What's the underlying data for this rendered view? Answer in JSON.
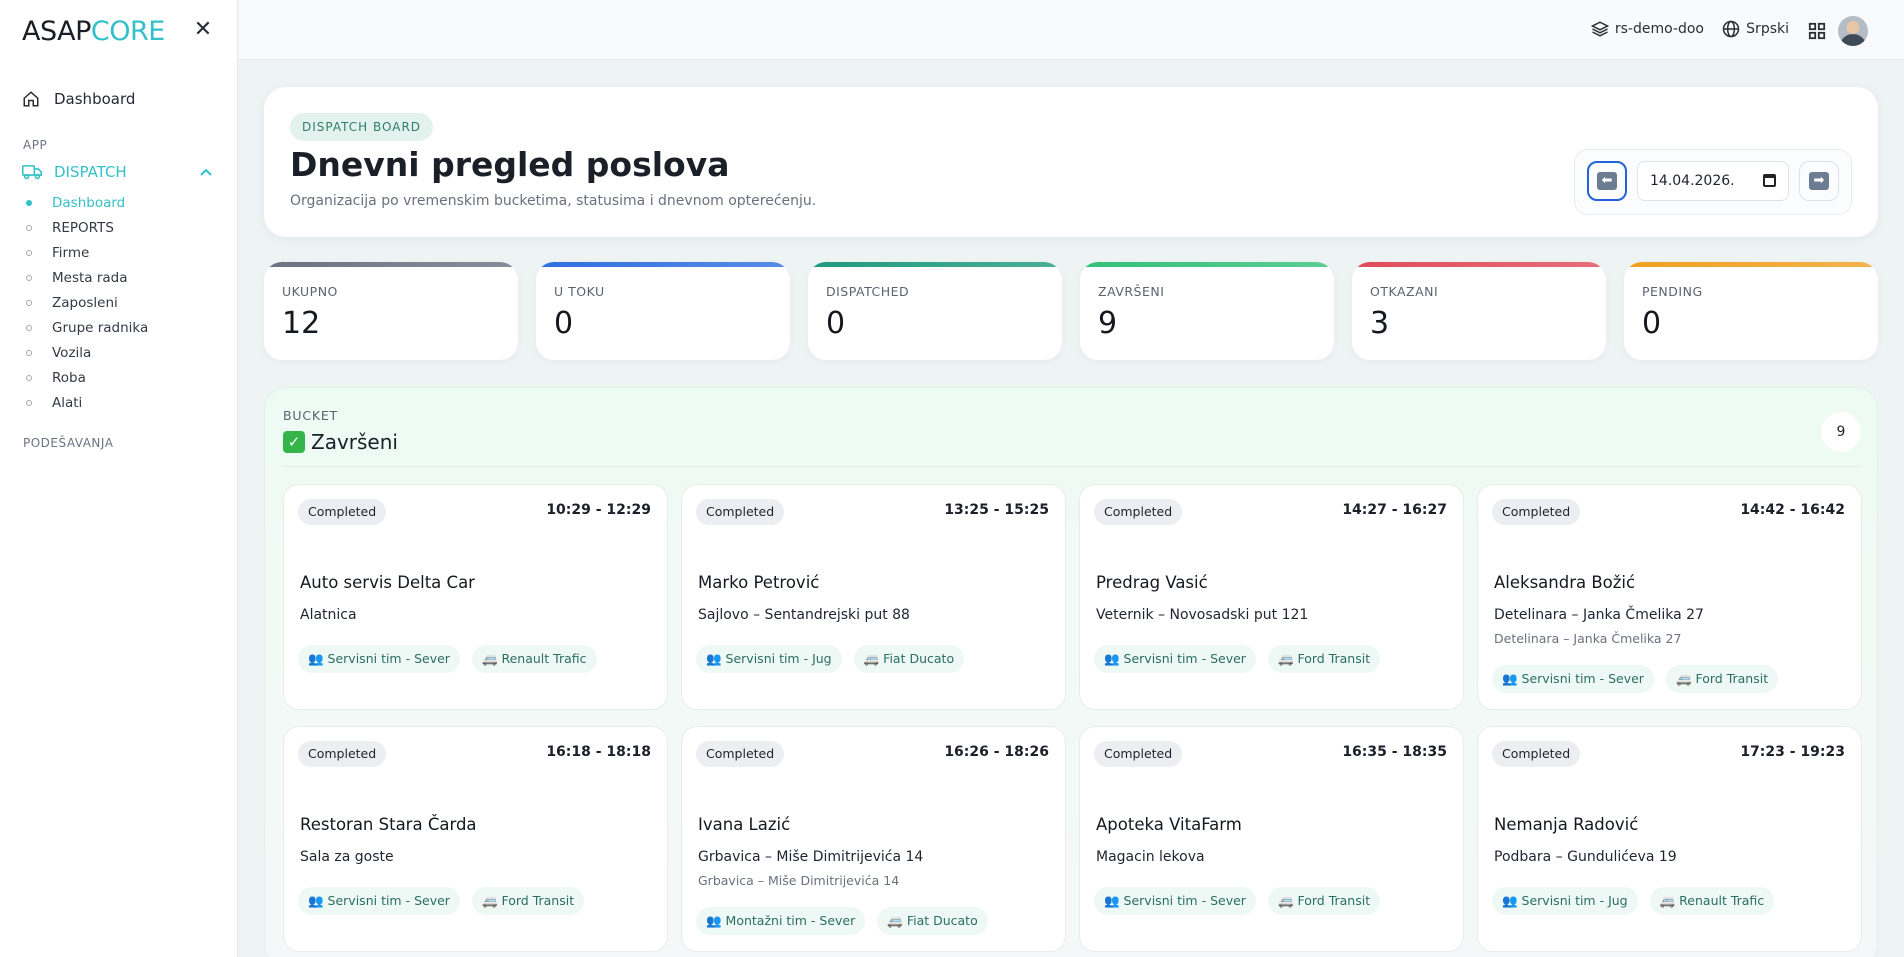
{
  "brand": {
    "part1": "ASAP",
    "part2": "CORE"
  },
  "sidebar": {
    "top_item": "Dashboard",
    "section_app": "APP",
    "group": "DISPATCH",
    "sub_items": [
      "Dashboard",
      "REPORTS",
      "Firme",
      "Mesta rada",
      "Zaposleni",
      "Grupe radnika",
      "Vozila",
      "Roba",
      "Alati"
    ],
    "section_settings": "PODEŠAVANJA"
  },
  "topbar": {
    "company": "rs-demo-doo",
    "language": "Srpski"
  },
  "header": {
    "pill": "DISPATCH BOARD",
    "title": "Dnevni pregled poslova",
    "subtitle": "Organizacija po vremenskim bucketima, statusima i dnevnom opterećenju.",
    "date": "14.04.2026."
  },
  "stats": [
    {
      "label": "UKUPNO",
      "value": "12",
      "color": "#6b7280"
    },
    {
      "label": "U TOKU",
      "value": "0",
      "color": "#2f6fe0"
    },
    {
      "label": "DISPATCHED",
      "value": "0",
      "color": "#1f9a7e"
    },
    {
      "label": "ZAVRŠENI",
      "value": "9",
      "color": "#34c07a"
    },
    {
      "label": "OTKAZANI",
      "value": "3",
      "color": "#e04b59"
    },
    {
      "label": "PENDING",
      "value": "0",
      "color": "#f0a020"
    }
  ],
  "bucket": {
    "label": "BUCKET",
    "title": "Završeni",
    "count": "9",
    "jobs": [
      {
        "status": "Completed",
        "time": "10:29 - 12:29",
        "name": "Auto servis Delta Car",
        "address": "Alatnica",
        "address2": "",
        "team": "Servisni tim - Sever",
        "vehicle": "Renault Trafic"
      },
      {
        "status": "Completed",
        "time": "13:25 - 15:25",
        "name": "Marko Petrović",
        "address": "Sajlovo – Sentandrejski put 88",
        "address2": "",
        "team": "Servisni tim - Jug",
        "vehicle": "Fiat Ducato"
      },
      {
        "status": "Completed",
        "time": "14:27 - 16:27",
        "name": "Predrag Vasić",
        "address": "Veternik – Novosadski put 121",
        "address2": "",
        "team": "Servisni tim - Sever",
        "vehicle": "Ford Transit"
      },
      {
        "status": "Completed",
        "time": "14:42 - 16:42",
        "name": "Aleksandra Božić",
        "address": "Detelinara – Janka Čmelika 27",
        "address2": "Detelinara – Janka Čmelika 27",
        "team": "Servisni tim - Sever",
        "vehicle": "Ford Transit"
      },
      {
        "status": "Completed",
        "time": "16:18 - 18:18",
        "name": "Restoran Stara Čarda",
        "address": "Sala za goste",
        "address2": "",
        "team": "Servisni tim - Sever",
        "vehicle": "Ford Transit"
      },
      {
        "status": "Completed",
        "time": "16:26 - 18:26",
        "name": "Ivana Lazić",
        "address": "Grbavica – Miše Dimitrijevića 14",
        "address2": "Grbavica – Miše Dimitrijevića 14",
        "team": "Montažni tim - Sever",
        "vehicle": "Fiat Ducato"
      },
      {
        "status": "Completed",
        "time": "16:35 - 18:35",
        "name": "Apoteka VitaFarm",
        "address": "Magacin lekova",
        "address2": "",
        "team": "Servisni tim - Sever",
        "vehicle": "Ford Transit"
      },
      {
        "status": "Completed",
        "time": "17:23 - 19:23",
        "name": "Nemanja Radović",
        "address": "Podbara – Gundulićeva 19",
        "address2": "",
        "team": "Servisni tim - Jug",
        "vehicle": "Renault Trafic"
      }
    ]
  }
}
